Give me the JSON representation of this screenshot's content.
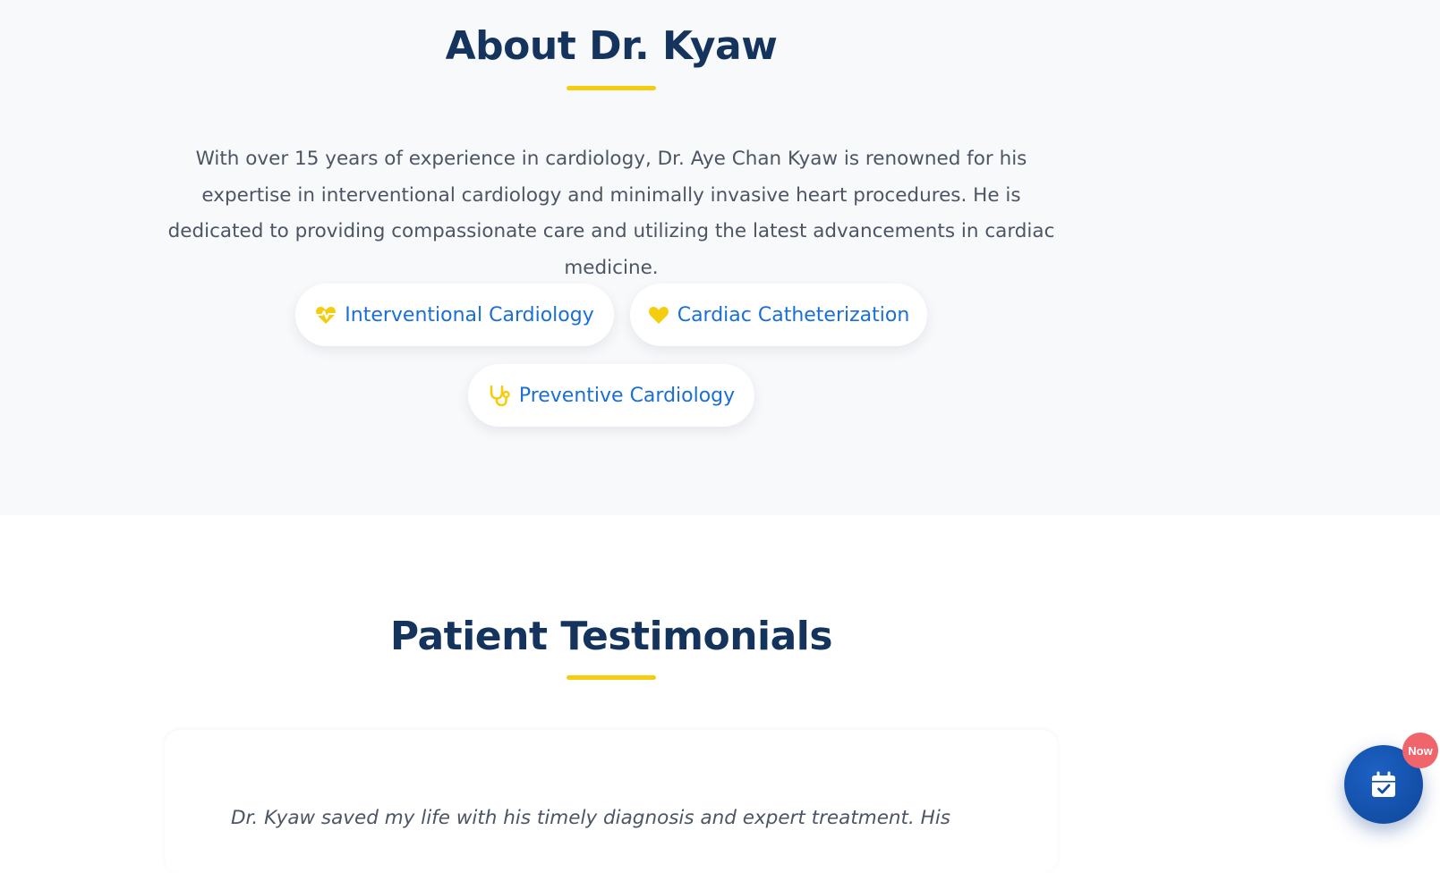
{
  "about": {
    "title": "About Dr. Kyaw",
    "paragraph": "With over 15 years of experience in cardiology, Dr. Aye Chan Kyaw is renowned for his expertise in interventional cardiology and minimally invasive heart procedures. He is dedicated to providing compassionate care and utilizing the latest advancements in cardiac medicine.",
    "specialties": [
      {
        "label": "Interventional Cardiology",
        "icon": "heart-pulse-icon"
      },
      {
        "label": "Cardiac Catheterization",
        "icon": "heart-icon"
      },
      {
        "label": "Preventive Cardiology",
        "icon": "stethoscope-icon"
      }
    ]
  },
  "testimonials": {
    "title": "Patient Testimonials",
    "items": [
      {
        "quote": "Dr. Kyaw saved my life with his timely diagnosis and expert treatment. His"
      }
    ]
  },
  "booking_fab": {
    "icon": "calendar-check-icon",
    "badge": "Now"
  },
  "colors": {
    "navy": "#14345e",
    "accent_yellow": "#f6cd0e",
    "link_blue": "#1a6fd6",
    "fab_blue": "#134ea6",
    "badge_red": "#f0646b"
  }
}
